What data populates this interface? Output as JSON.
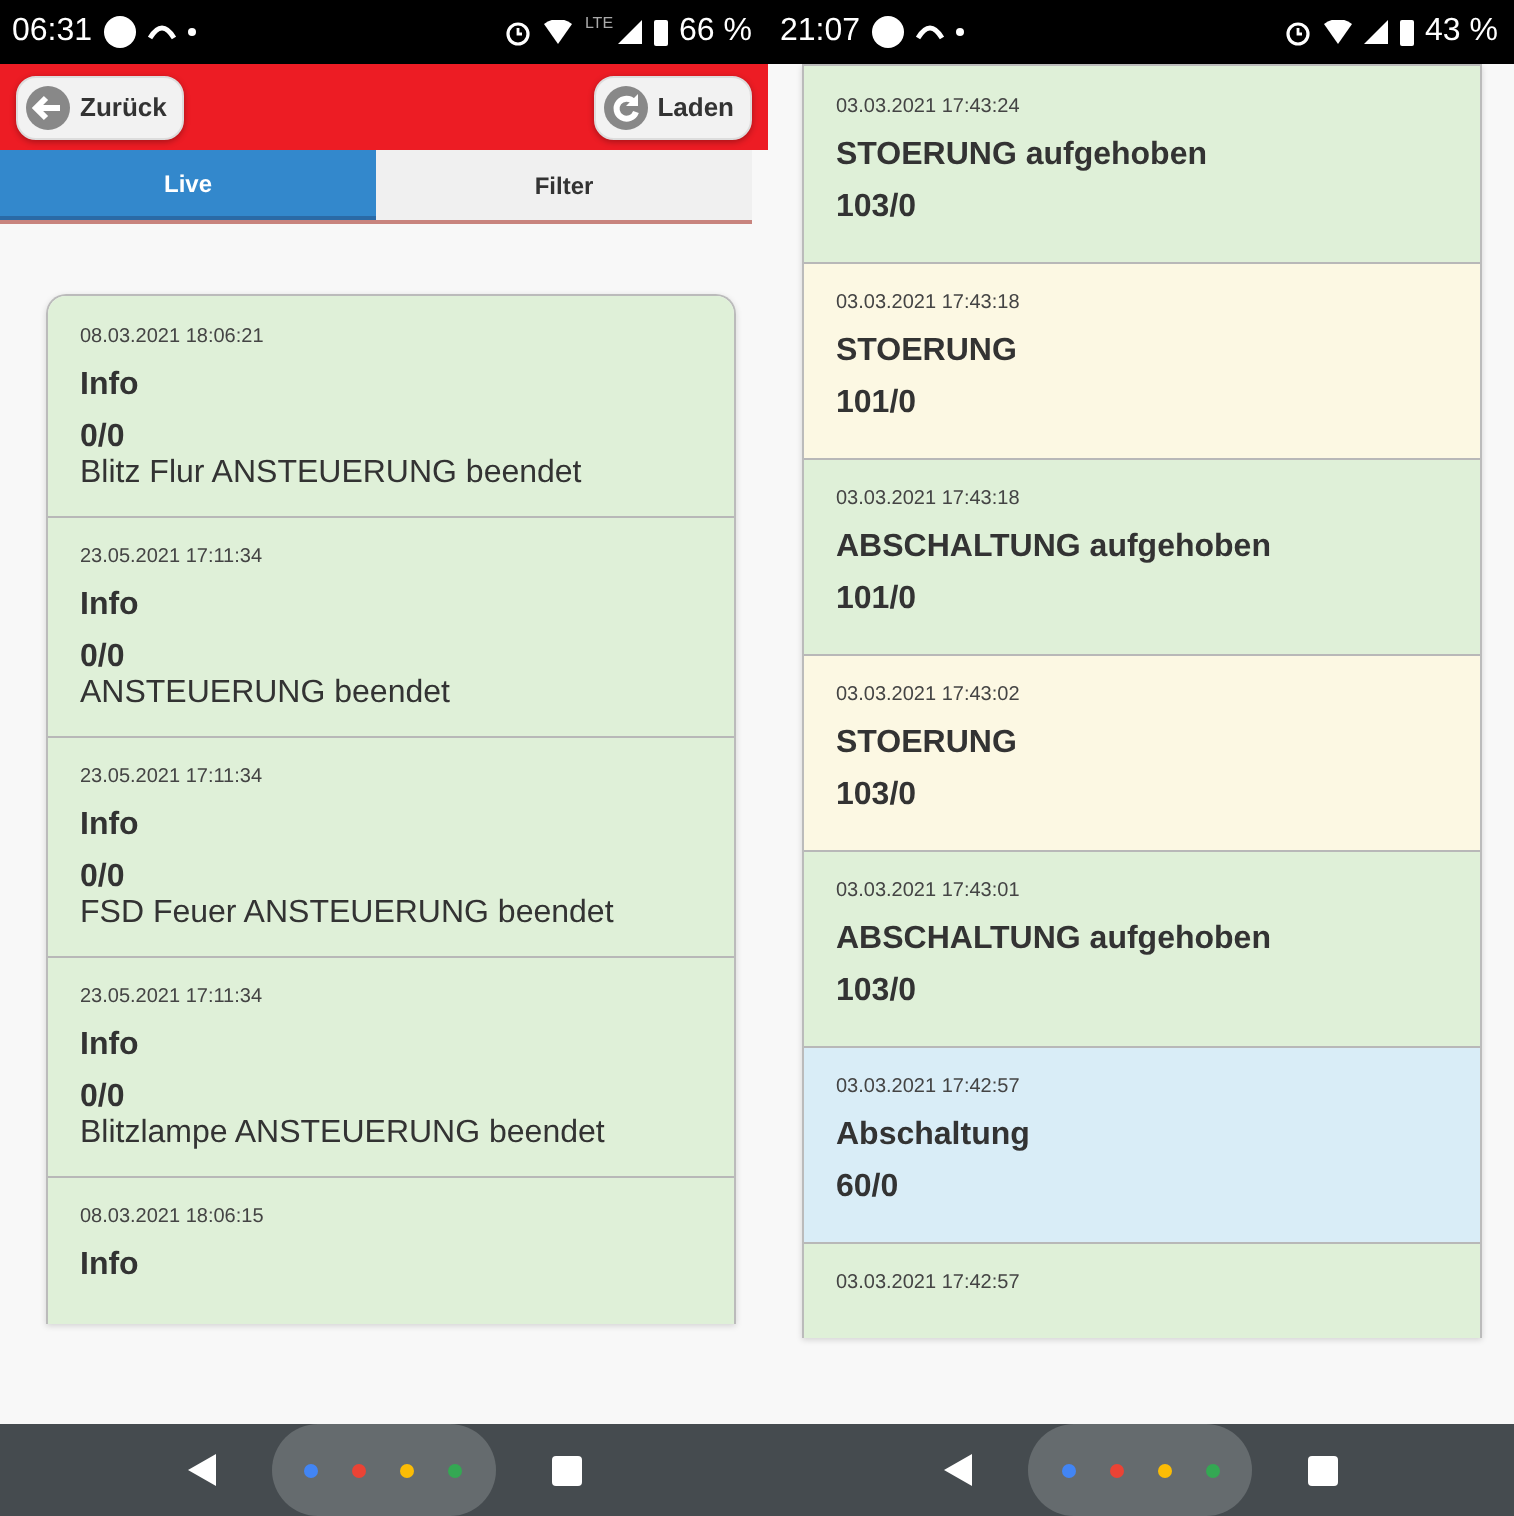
{
  "phones": [
    {
      "status_bar": {
        "time": "06:31",
        "network": "LTE",
        "battery": "66 %"
      },
      "header": {
        "back_button": "Zurück",
        "reload_button": "Laden"
      },
      "tabs": [
        {
          "label": "Live",
          "selected": true
        },
        {
          "label": "Filter",
          "selected": false
        }
      ],
      "events": [
        {
          "timestamp": "08.03.2021 18:06:21",
          "title": "Info",
          "code": "0/0",
          "text": "Blitz Flur ANSTEUERUNG beendet",
          "color": "#dff0d8"
        },
        {
          "timestamp": "23.05.2021 17:11:34",
          "title": "Info",
          "code": "0/0",
          "text": "ANSTEUERUNG beendet",
          "color": "#dff0d8"
        },
        {
          "timestamp": "23.05.2021 17:11:34",
          "title": "Info",
          "code": "0/0",
          "text": "FSD Feuer ANSTEUERUNG beendet",
          "color": "#dff0d8"
        },
        {
          "timestamp": "23.05.2021 17:11:34",
          "title": "Info",
          "code": "0/0",
          "text": "Blitzlampe ANSTEUERUNG beendet",
          "color": "#dff0d8"
        },
        {
          "timestamp": "08.03.2021 18:06:15",
          "title": "Info",
          "color": "#dff0d8"
        }
      ]
    },
    {
      "status_bar": {
        "time": "21:07",
        "battery": "43 %"
      },
      "events": [
        {
          "timestamp": "03.03.2021 17:43:24",
          "title": "STOERUNG aufgehoben",
          "code": "103/0",
          "color": "#dff0d8"
        },
        {
          "timestamp": "03.03.2021 17:43:18",
          "title": "STOERUNG",
          "code": "101/0",
          "color": "#fcf8e3"
        },
        {
          "timestamp": "03.03.2021 17:43:18",
          "title": "ABSCHALTUNG aufgehoben",
          "code": "101/0",
          "color": "#dff0d8"
        },
        {
          "timestamp": "03.03.2021 17:43:02",
          "title": "STOERUNG",
          "code": "103/0",
          "color": "#fcf8e3"
        },
        {
          "timestamp": "03.03.2021 17:43:01",
          "title": "ABSCHALTUNG aufgehoben",
          "code": "103/0",
          "color": "#dff0d8"
        },
        {
          "timestamp": "03.03.2021 17:42:57",
          "title": "Abschaltung",
          "code": "60/0",
          "color": "#d9edf7"
        },
        {
          "timestamp": "03.03.2021 17:42:57",
          "color": "#dff0d8"
        }
      ]
    }
  ]
}
